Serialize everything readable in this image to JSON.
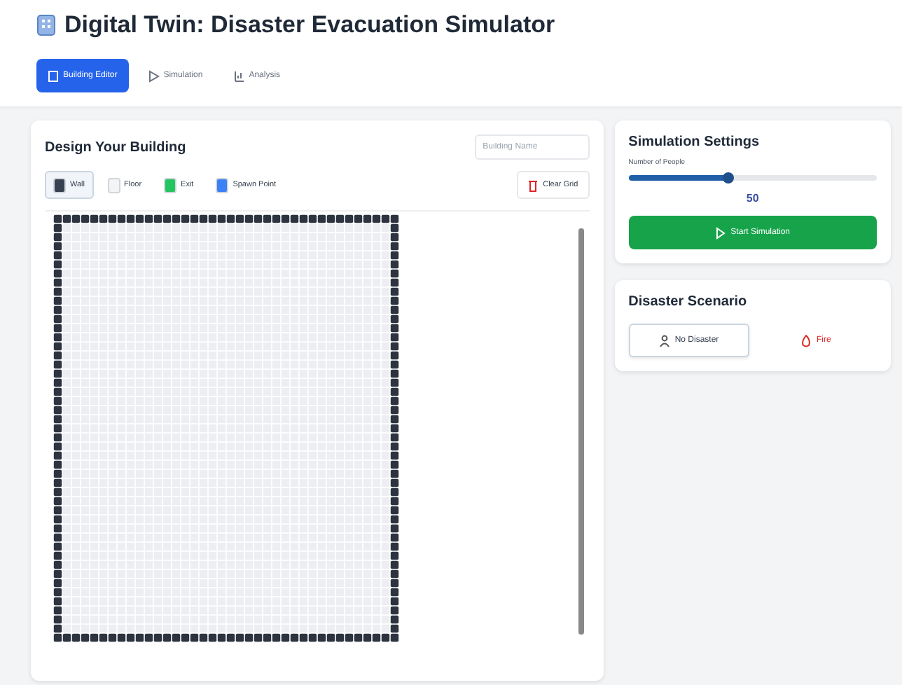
{
  "title": "Digital Twin: Disaster Evacuation Simulator",
  "tabs": [
    {
      "label": "Building Editor",
      "selected": true,
      "kind": "editor"
    },
    {
      "label": "Simulation",
      "selected": false,
      "kind": "simulation"
    },
    {
      "label": "Analysis",
      "selected": false,
      "kind": "analysis"
    }
  ],
  "editor": {
    "heading": "Design Your Building",
    "name_field": {
      "placeholder": "Building Name"
    },
    "tools": [
      {
        "label": "Wall",
        "selected": true,
        "color": "#374151"
      },
      {
        "label": "Floor",
        "selected": false,
        "color": "#f3f4f6"
      },
      {
        "label": "Exit",
        "selected": false,
        "color": "#22c55e"
      },
      {
        "label": "Spawn Point",
        "selected": false,
        "color": "#3b82f6"
      }
    ],
    "clear_button": "Clear Grid"
  },
  "settings": {
    "heading": "Simulation Settings",
    "people_label": "Number of People",
    "people_slider": {
      "level": 0.4
    },
    "people_value": "50",
    "start_button": "Start Simulation"
  },
  "scenario": {
    "heading": "Disaster Scenario",
    "options": [
      {
        "label": "No Disaster",
        "selected": true,
        "kind": "none"
      },
      {
        "label": "Fire",
        "selected": false,
        "kind": "fire"
      }
    ]
  }
}
